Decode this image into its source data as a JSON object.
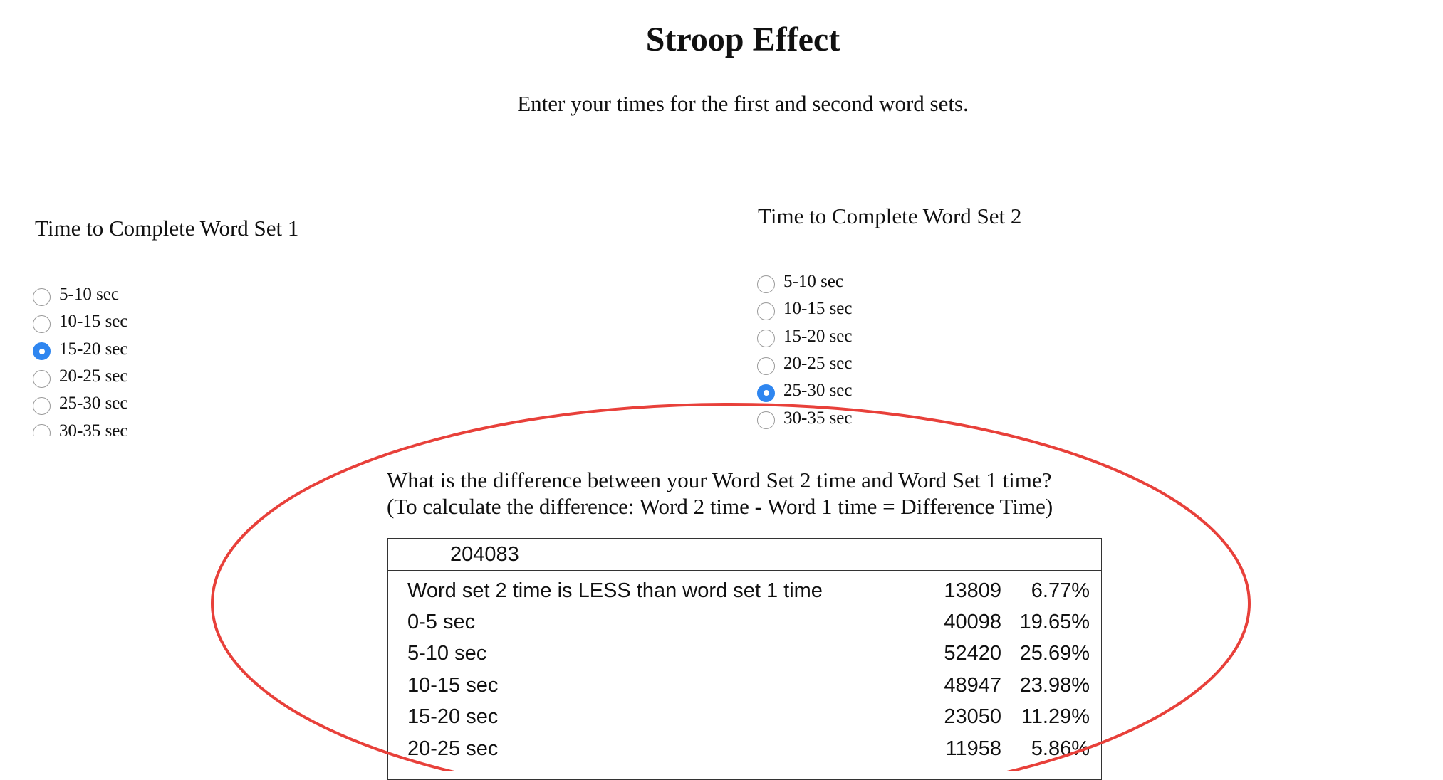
{
  "title": "Stroop Effect",
  "instructions": "Enter your times for the first and second word sets.",
  "word_set_1": {
    "heading": "Time to Complete Word Set 1",
    "options": [
      "5-10 sec",
      "10-15 sec",
      "15-20 sec",
      "20-25 sec",
      "25-30 sec",
      "30-35 sec"
    ],
    "selected": "15-20 sec"
  },
  "word_set_2": {
    "heading": "Time to Complete Word Set 2",
    "options": [
      "5-10 sec",
      "10-15 sec",
      "15-20 sec",
      "20-25 sec",
      "25-30 sec",
      "30-35 sec"
    ],
    "selected": "25-30 sec"
  },
  "question": {
    "line1": "What is the difference between your Word Set 2 time and Word Set 1 time?",
    "line2": "(To calculate the difference: Word 2 time - Word 1 time = Difference Time)"
  },
  "results": {
    "total": "204083",
    "rows": [
      {
        "label": "Word set 2 time is LESS than word set 1 time",
        "count": "13809",
        "percent": "6.77%"
      },
      {
        "label": "0-5 sec",
        "count": "40098",
        "percent": "19.65%"
      },
      {
        "label": "5-10 sec",
        "count": "52420",
        "percent": "25.69%"
      },
      {
        "label": "10-15 sec",
        "count": "48947",
        "percent": "23.98%"
      },
      {
        "label": "15-20 sec",
        "count": "23050",
        "percent": "11.29%"
      },
      {
        "label": "20-25 sec",
        "count": "11958",
        "percent": "5.86%"
      }
    ]
  },
  "colors": {
    "radio_selected": "#2f86f0",
    "annotation_ellipse": "#e8403a"
  }
}
